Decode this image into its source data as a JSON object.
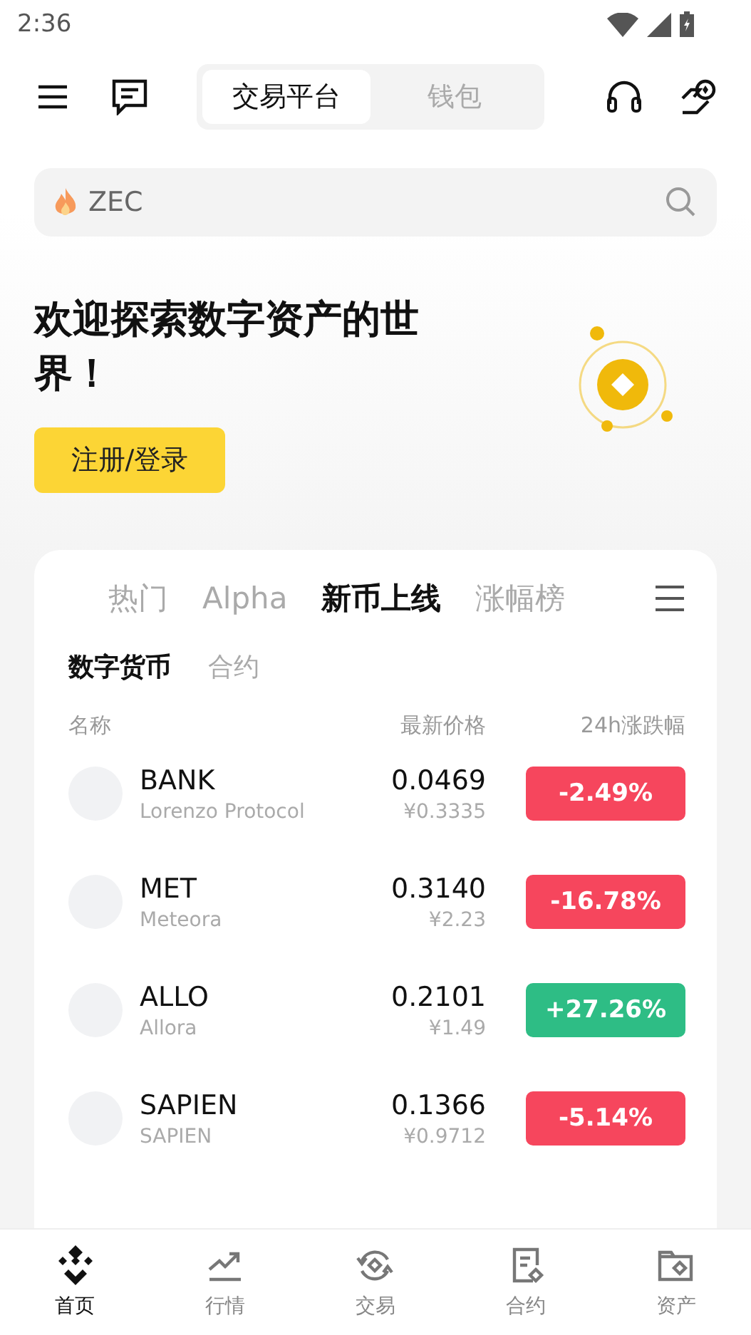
{
  "status_bar": {
    "time": "2:36"
  },
  "header": {
    "tabs": [
      {
        "label": "交易平台",
        "selected": true
      },
      {
        "label": "钱包",
        "selected": false
      }
    ]
  },
  "search": {
    "placeholder": "ZEC"
  },
  "hero": {
    "title": "欢迎探索数字资产的世界！",
    "button": "注册/登录"
  },
  "market_tabs": [
    {
      "label": "热门",
      "selected": false
    },
    {
      "label": "Alpha",
      "selected": false
    },
    {
      "label": "新币上线",
      "selected": true
    },
    {
      "label": "涨幅榜",
      "selected": false
    }
  ],
  "sub_tabs": [
    {
      "label": "数字货币",
      "selected": true
    },
    {
      "label": "合约",
      "selected": false
    }
  ],
  "columns": [
    "名称",
    "最新价格",
    "24h涨跌幅"
  ],
  "coins": [
    {
      "symbol": "BANK",
      "name": "Lorenzo Protocol",
      "price": "0.0469",
      "fiat": "¥0.3335",
      "change": "-2.49%",
      "color": "#f6465d"
    },
    {
      "symbol": "MET",
      "name": "Meteora",
      "price": "0.3140",
      "fiat": "¥2.23",
      "change": "-16.78%",
      "color": "#f6465d"
    },
    {
      "symbol": "ALLO",
      "name": "Allora",
      "price": "0.2101",
      "fiat": "¥1.49",
      "change": "+27.26%",
      "color": "#2ebd85"
    },
    {
      "symbol": "SAPIEN",
      "name": "SAPIEN",
      "price": "0.1366",
      "fiat": "¥0.9712",
      "change": "-5.14%",
      "color": "#f6465d"
    }
  ],
  "nav": [
    {
      "label": "首页",
      "kind": "home",
      "selected": true
    },
    {
      "label": "行情",
      "kind": "markets",
      "selected": false
    },
    {
      "label": "交易",
      "kind": "trade",
      "selected": false
    },
    {
      "label": "合约",
      "kind": "futures",
      "selected": false
    },
    {
      "label": "资产",
      "kind": "assets",
      "selected": false
    }
  ]
}
